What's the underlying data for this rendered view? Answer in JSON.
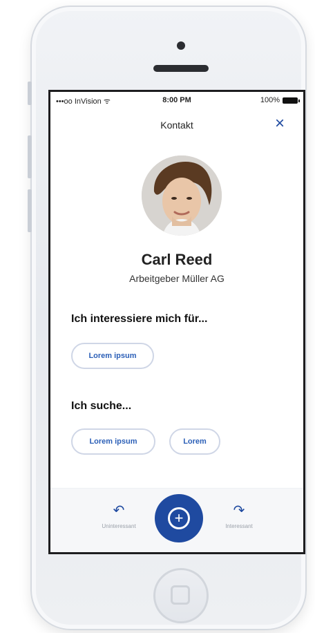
{
  "status": {
    "carrier": "•••oo InVision ᯤ",
    "time": "8:00 PM",
    "battery": "100%"
  },
  "header": {
    "title": "Kontakt",
    "close_icon": "×"
  },
  "profile": {
    "name": "Carl Reed",
    "company": "Arbeitgeber Müller AG"
  },
  "interests": {
    "title": "Ich interessiere mich für...",
    "chips": [
      "Lorem ipsum"
    ]
  },
  "search": {
    "title": "Ich suche...",
    "chips": [
      "Lorem ipsum",
      "Lorem"
    ]
  },
  "bottom": {
    "left": {
      "label": "Uninteressant",
      "icon": "↶"
    },
    "center": {
      "icon": "+"
    },
    "right": {
      "label": "Interessant",
      "icon": "↷"
    }
  }
}
